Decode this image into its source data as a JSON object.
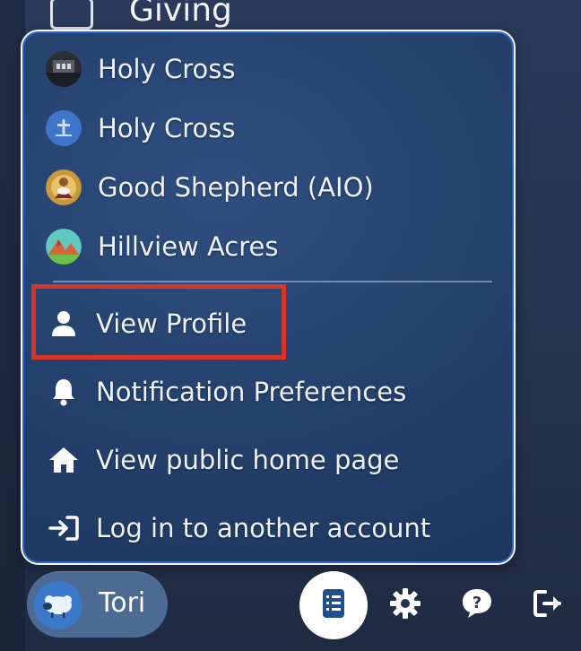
{
  "background": {
    "section_label": "Giving"
  },
  "menu": {
    "organizations": [
      {
        "label": "Holy Cross",
        "icon": "church-photo-avatar"
      },
      {
        "label": "Holy Cross",
        "icon": "cross-avatar"
      },
      {
        "label": "Good Shepherd (AIO)",
        "icon": "shepherd-avatar"
      },
      {
        "label": "Hillview Acres",
        "icon": "mountain-avatar"
      }
    ],
    "actions": [
      {
        "label": "View Profile",
        "icon": "person-icon"
      },
      {
        "label": "Notification Preferences",
        "icon": "bell-icon"
      },
      {
        "label": "View public home page",
        "icon": "home-icon"
      },
      {
        "label": "Log in to another account",
        "icon": "login-icon"
      }
    ]
  },
  "footer": {
    "user": {
      "name": "Tori",
      "icon": "sheep-avatar"
    },
    "tools": [
      "tasks-icon",
      "gear-icon",
      "help-icon",
      "logout-icon"
    ]
  },
  "colors": {
    "highlight": "#d7342a",
    "menu_border": "#f5f8ff",
    "accent": "#3a78c9"
  }
}
